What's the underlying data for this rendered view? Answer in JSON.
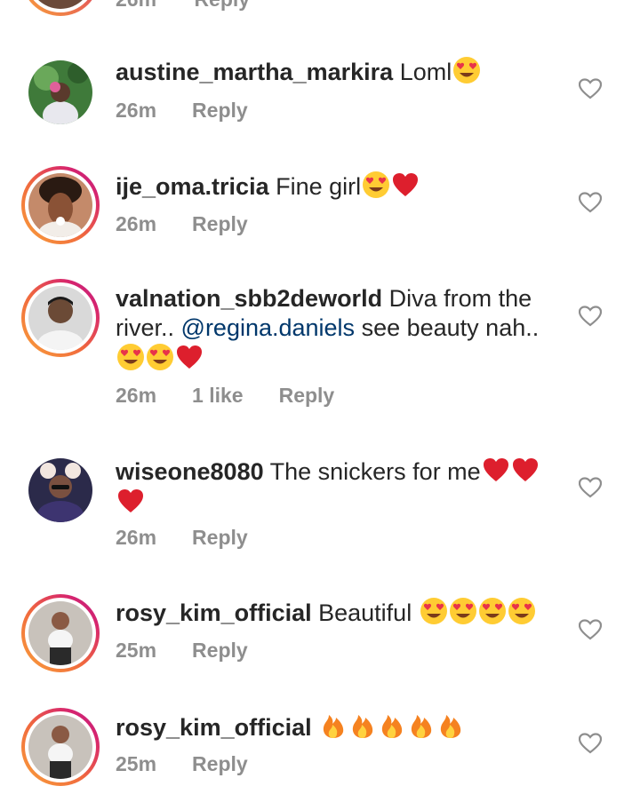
{
  "partial_top": {
    "time": "26m",
    "reply": "Reply"
  },
  "comments": [
    {
      "username": "austine_martha_markira",
      "text": "Loml",
      "emoji": [
        "heart-eyes"
      ],
      "time": "26m",
      "likes": "",
      "reply": "Reply",
      "story_ring": false
    },
    {
      "username": "ije_oma.tricia",
      "text": "Fine girl",
      "emoji": [
        "heart-eyes",
        "red-heart"
      ],
      "time": "26m",
      "likes": "",
      "reply": "Reply",
      "story_ring": true
    },
    {
      "username": "valnation_sbb2deworld",
      "text_before": "Diva from the river..",
      "mention": "@regina.daniels",
      "text_after": "see beauty nah..",
      "emoji": [
        "heart-eyes",
        "heart-eyes",
        "red-heart"
      ],
      "time": "26m",
      "likes": "1 like",
      "reply": "Reply",
      "story_ring": true
    },
    {
      "username": "wiseone8080",
      "text": "The snickers for me",
      "emoji": [
        "red-heart",
        "red-heart",
        "red-heart"
      ],
      "time": "26m",
      "likes": "",
      "reply": "Reply",
      "story_ring": false
    },
    {
      "username": "rosy_kim_official",
      "text": "Beautiful",
      "emoji": [
        "heart-eyes",
        "heart-eyes",
        "heart-eyes",
        "heart-eyes"
      ],
      "time": "25m",
      "likes": "",
      "reply": "Reply",
      "story_ring": true
    },
    {
      "username": "rosy_kim_official",
      "text": "",
      "emoji": [
        "fire",
        "fire",
        "fire",
        "fire",
        "fire"
      ],
      "time": "25m",
      "likes": "",
      "reply": "Reply",
      "story_ring": true
    }
  ],
  "icons": {
    "like": "heart-outline-icon"
  },
  "colors": {
    "username": "#262626",
    "meta": "#8e8e8e",
    "mention": "#00376b",
    "ring_start": "#f9a23a",
    "ring_end": "#b72688"
  }
}
